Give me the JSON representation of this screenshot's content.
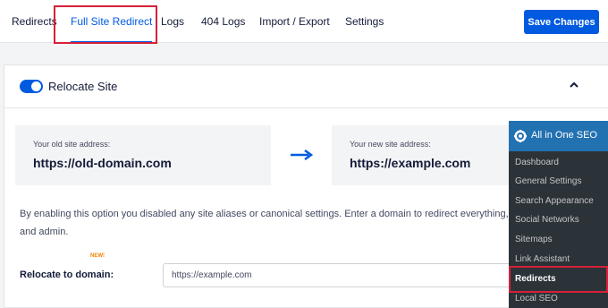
{
  "tabs": [
    {
      "label": "Redirects",
      "active": false
    },
    {
      "label": "Full Site Redirect",
      "active": true
    },
    {
      "label": "Logs",
      "active": false
    },
    {
      "label": "404 Logs",
      "active": false
    },
    {
      "label": "Import / Export",
      "active": false
    },
    {
      "label": "Settings",
      "active": false
    }
  ],
  "save_button": "Save Changes",
  "card": {
    "title": "Relocate Site",
    "toggle_on": true,
    "old_address": {
      "label": "Your old site address:",
      "value": "https://old-domain.com"
    },
    "new_address": {
      "label": "Your new site address:",
      "value": "https://example.com"
    },
    "description": "By enabling this option you disabled any site aliases or canonical settings. Enter a domain to redirect everything, exc login and admin.",
    "relocate_label": "Relocate to domain:",
    "relocate_value": "https://example.com"
  },
  "wp_menu": {
    "title": "All in One SEO",
    "items": [
      {
        "label": "Dashboard"
      },
      {
        "label": "General Settings"
      },
      {
        "label": "Search Appearance"
      },
      {
        "label": "Social Networks"
      },
      {
        "label": "Sitemaps"
      },
      {
        "label": "Link Assistant",
        "badge": "NEW!"
      },
      {
        "label": "Redirects",
        "current": true
      },
      {
        "label": "Local SEO"
      }
    ]
  },
  "colors": {
    "accent": "#005ae0",
    "highlight": "#d7203a",
    "wp_menu_bg": "#2c3338",
    "wp_menu_header": "#2271b1",
    "new_badge": "#f18500"
  },
  "icons": {
    "toggle": "toggle-switch-icon",
    "collapse": "chevron-up-icon",
    "arrow": "arrow-right-icon",
    "logo": "aioseo-logo-icon"
  }
}
